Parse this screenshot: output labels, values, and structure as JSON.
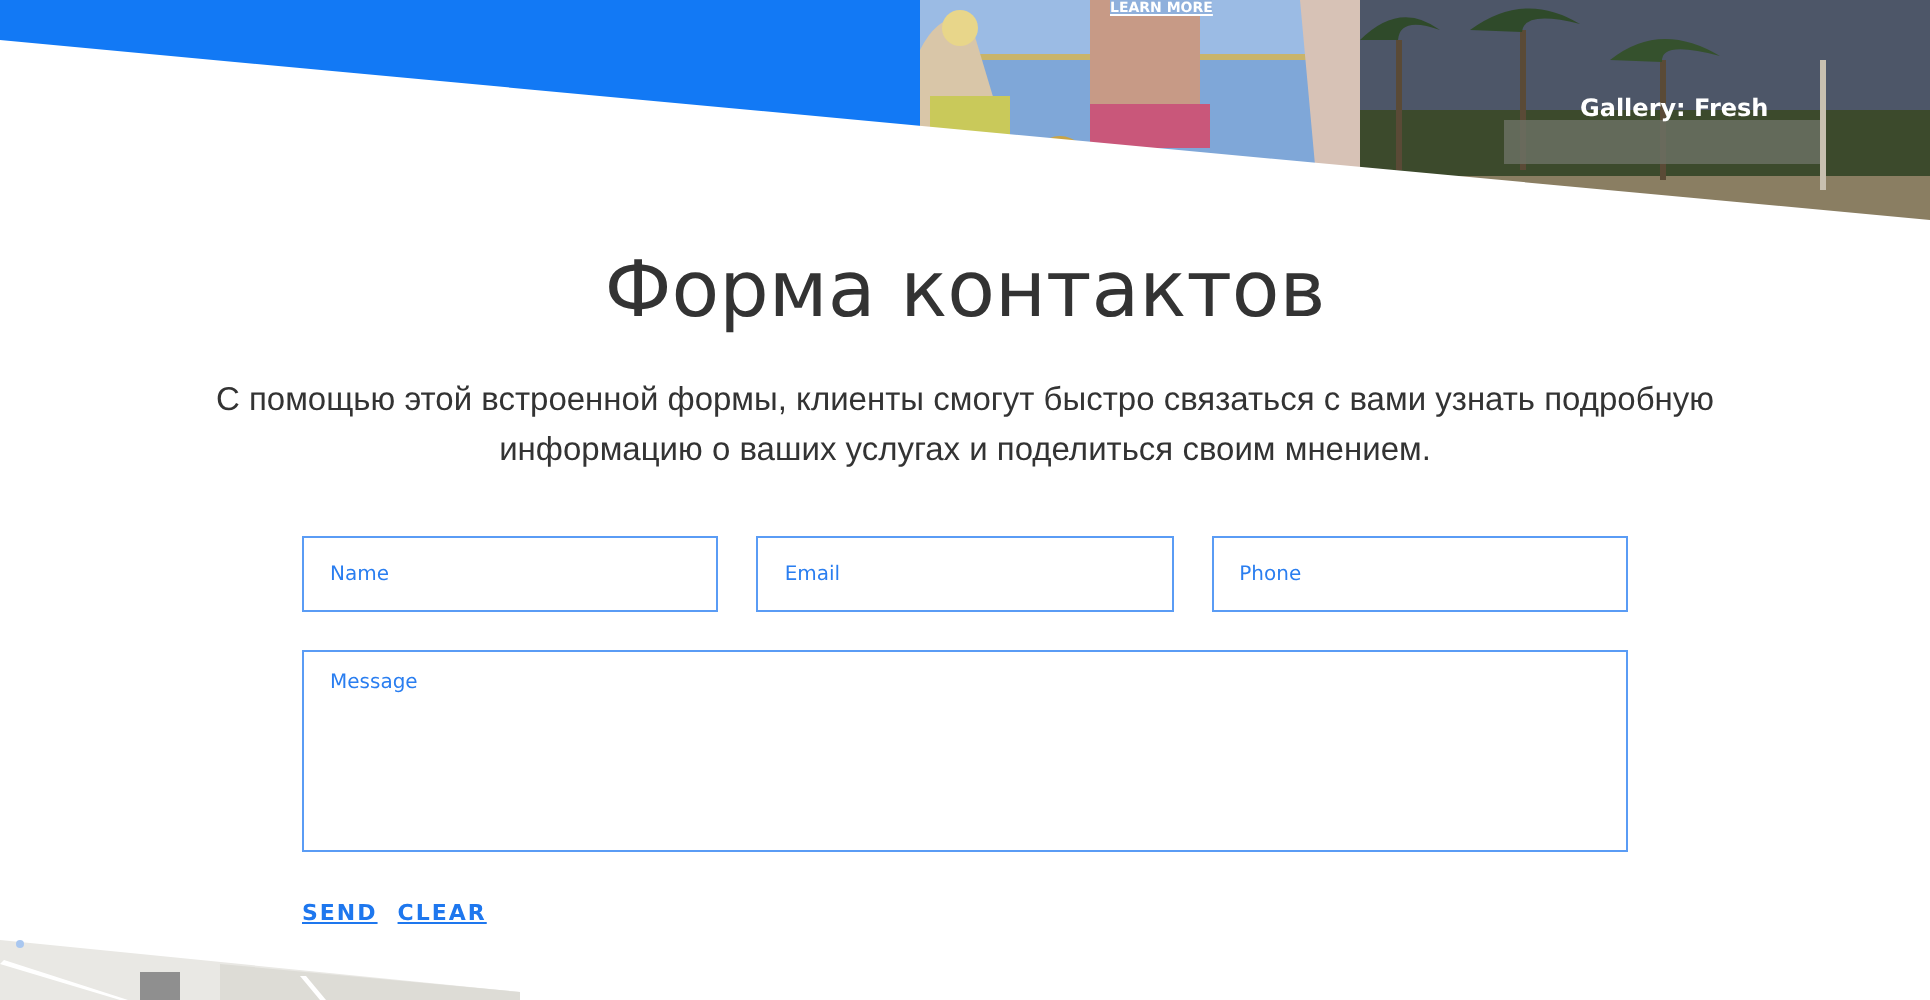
{
  "hero": {
    "link": "LEARN MORE",
    "caption": "Gallery: Fresh"
  },
  "heading": "Форма контактов",
  "description": "С помощью этой встроенной формы, клиенты смогут быстро связаться с вами узнать подробную информацию о ваших услугах и поделиться своим мнением.",
  "form": {
    "fields": [
      {
        "placeholder": "Name"
      },
      {
        "placeholder": "Email"
      },
      {
        "placeholder": "Phone"
      }
    ],
    "message": {
      "placeholder": "Message"
    },
    "actions": [
      "SEND",
      "CLEAR"
    ]
  }
}
